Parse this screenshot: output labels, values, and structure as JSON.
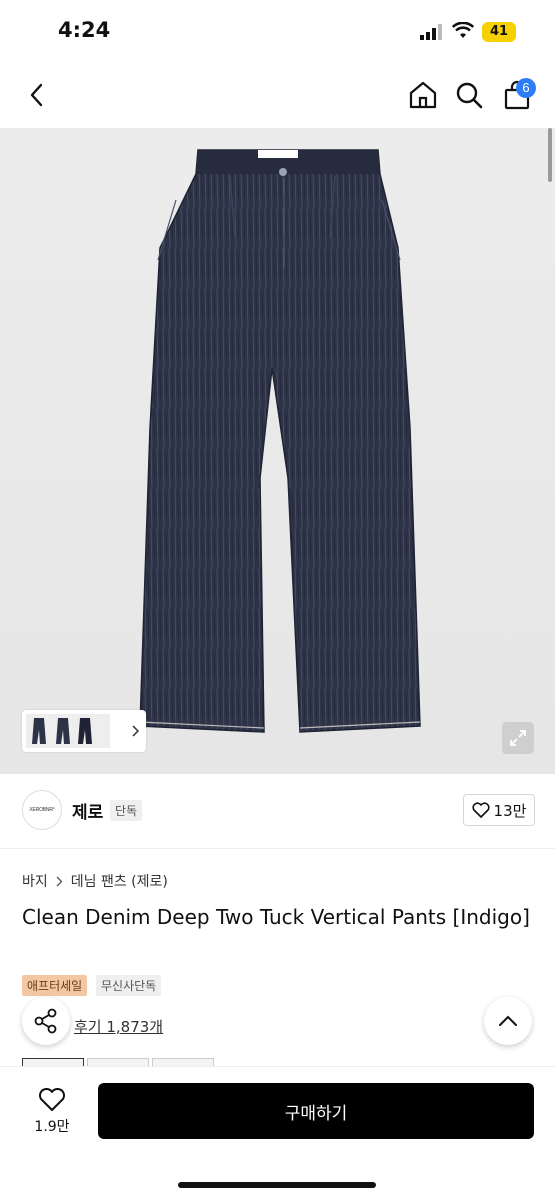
{
  "status": {
    "time": "4:24",
    "battery": "41"
  },
  "nav": {
    "cart_count": "6"
  },
  "brand": {
    "name": "제로",
    "badge": "단독",
    "logo_text": "XEROBNR°"
  },
  "product": {
    "likes": "13만",
    "breadcrumb": [
      "바지",
      "데님 팬츠 (제로)"
    ],
    "title": "Clean Denim Deep Two Tuck Vertical Pants [Indigo]",
    "tags": [
      "애프터세일",
      "무신사단독"
    ],
    "reviews": "후기 1,873개"
  },
  "bottom": {
    "wish_count": "1.9만",
    "buy_label": "구매하기"
  },
  "colors": {
    "accent_badge": "#2f7df6",
    "denim": "#2d3347",
    "sale_tag": "#f2c8a3"
  }
}
